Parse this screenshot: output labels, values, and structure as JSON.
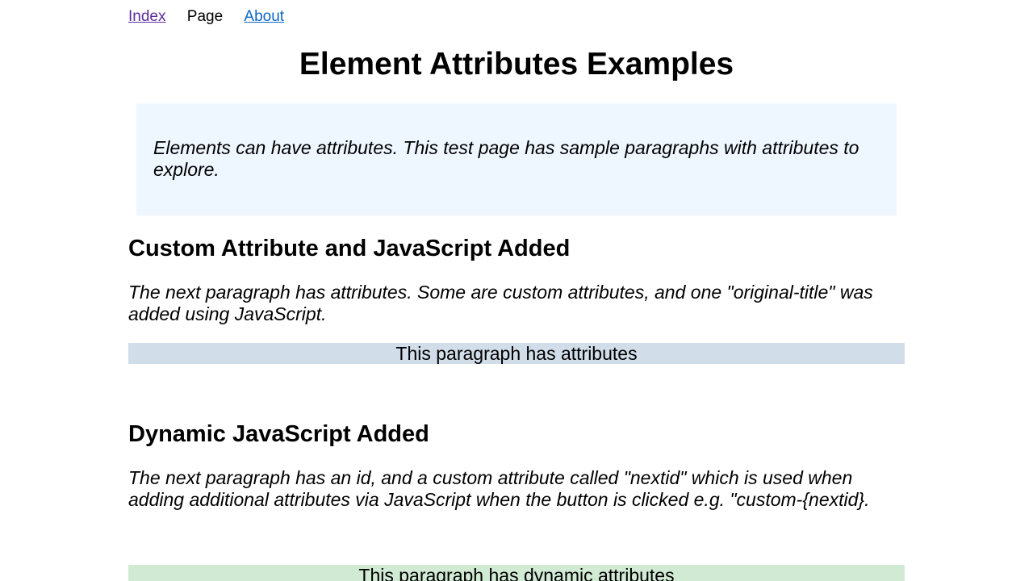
{
  "nav": {
    "index_label": "Index",
    "page_label": "Page",
    "about_label": "About"
  },
  "page_title": "Element Attributes Examples",
  "explanation": "Elements can have attributes. This test page has sample paragraphs with attributes to explore.",
  "sections": [
    {
      "heading": "Custom Attribute and JavaScript Added",
      "description": "The next paragraph has attributes. Some are custom attributes, and one \"original-title\" was added using JavaScript.",
      "paragraph": "This paragraph has attributes"
    },
    {
      "heading": "Dynamic JavaScript Added",
      "description": "The next paragraph has an id, and a custom attribute called \"nextid\" which is used when adding additional attributes via JavaScript when the button is clicked e.g. \"custom-{nextid}.",
      "paragraph": "This paragraph has dynamic attributes"
    }
  ],
  "colors": {
    "visited_link": "#5a2b9a",
    "link": "#0b67c2",
    "explanation_bg": "#eef6ff",
    "attributes_para_bg": "#d1dde9",
    "dynamic_para_bg": "#d1ead4"
  }
}
